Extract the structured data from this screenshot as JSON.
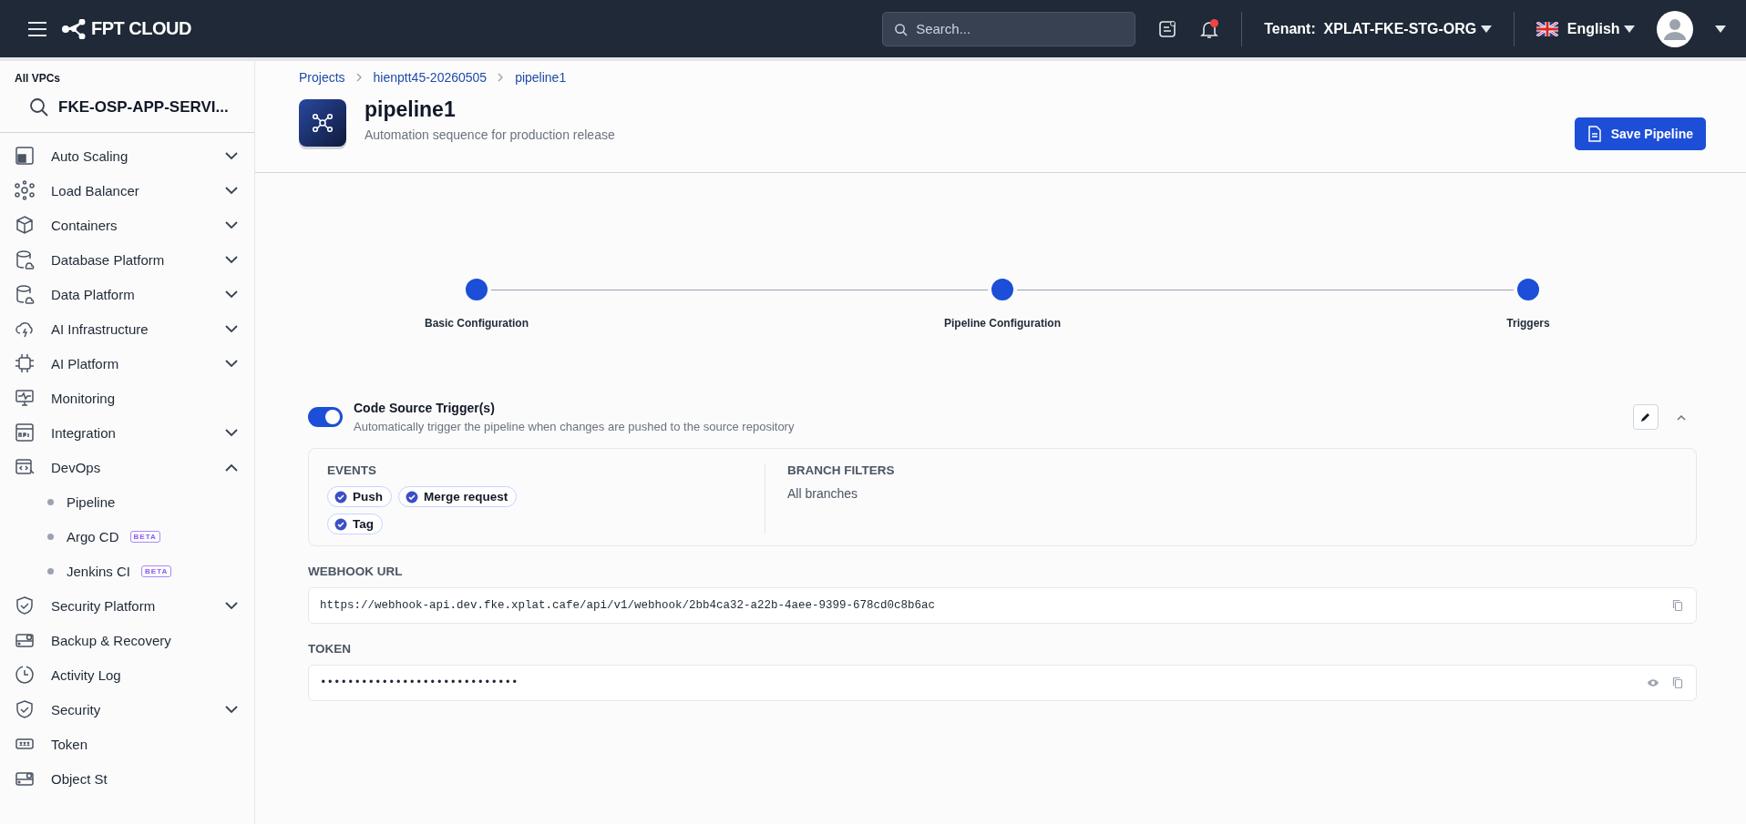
{
  "topbar": {
    "logo": "FPT CLOUD",
    "search": {
      "placeholder": "Search..."
    },
    "notification_dot": true,
    "tenant_label": "Tenant:",
    "tenant": "XPLAT-FKE-STG-ORG",
    "language": "English"
  },
  "sidebar": {
    "vpc_label": "All VPCs",
    "vpc": "FKE-OSP-APP-SERVI...",
    "items": [
      {
        "label": "Auto Scaling",
        "expanded": false
      },
      {
        "label": "Load Balancer",
        "expanded": false
      },
      {
        "label": "Containers",
        "expanded": false
      },
      {
        "label": "Database Platform",
        "expanded": false
      },
      {
        "label": "Data Platform",
        "expanded": false
      },
      {
        "label": "AI Infrastructure",
        "expanded": false
      },
      {
        "label": "AI Platform",
        "expanded": false
      },
      {
        "label": "Monitoring"
      },
      {
        "label": "Integration",
        "expanded": false
      },
      {
        "label": "DevOps",
        "expanded": true,
        "children": [
          {
            "label": "Pipeline"
          },
          {
            "label": "Argo CD",
            "badge": "BETA"
          },
          {
            "label": "Jenkins CI",
            "badge": "BETA"
          }
        ]
      },
      {
        "label": "Security Platform",
        "expanded": false
      },
      {
        "label": "Backup & Recovery"
      },
      {
        "label": "Activity Log"
      },
      {
        "label": "Security",
        "expanded": false
      },
      {
        "label": "Token"
      },
      {
        "label": "Object St"
      }
    ]
  },
  "breadcrumbs": [
    "Projects",
    "hienptt45-20260505",
    "pipeline1"
  ],
  "page": {
    "title": "pipeline1",
    "subtitle": "Automation sequence for production release",
    "save_button": "Save Pipeline"
  },
  "steps": [
    {
      "label": "Basic Configuration",
      "completed": true
    },
    {
      "label": "Pipeline Configuration",
      "completed": true
    },
    {
      "label": "Triggers",
      "completed": true
    }
  ],
  "trigger": {
    "on": true,
    "title": "Code Source Trigger(s)",
    "description": "Automatically trigger the pipeline when changes are pushed to the source repository",
    "expanded": true,
    "events_label": "EVENTS",
    "events": [
      "Push",
      "Merge request",
      "Tag"
    ],
    "branch_label": "BRANCH FILTERS",
    "branch_value": "All branches",
    "webhook_label": "WEBHOOK URL",
    "webhook_url": "https://webhook-api.dev.fke.xplat.cafe/api/v1/webhook/2bb4ca32-a22b-4aee-9399-678cd0c8b6ac",
    "token_label": "TOKEN",
    "token": "•••••••••••••••••••••••••••••"
  }
}
